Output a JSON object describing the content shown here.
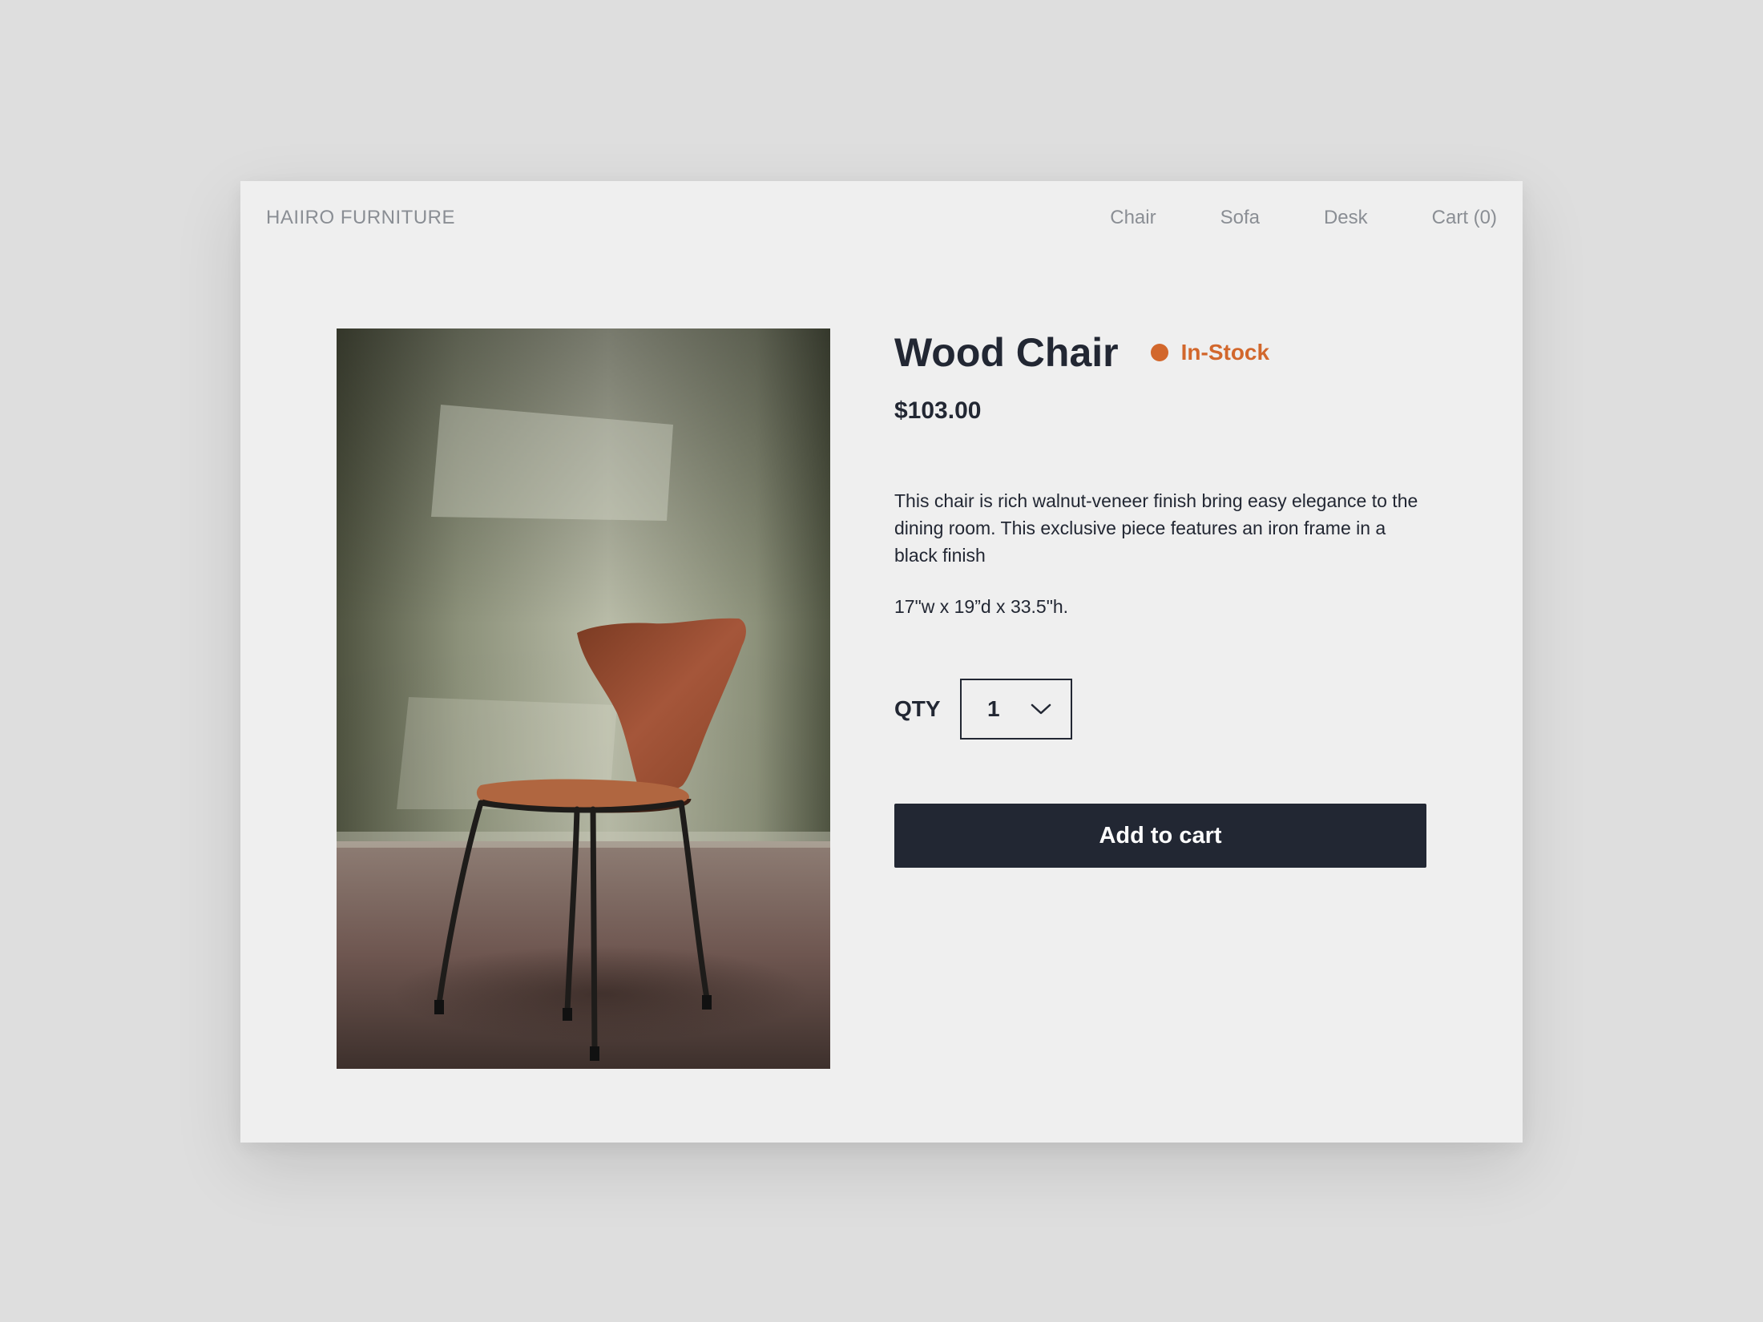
{
  "header": {
    "brand": "HAIIRO FURNITURE",
    "nav": [
      {
        "label": "Chair"
      },
      {
        "label": "Sofa"
      },
      {
        "label": "Desk"
      },
      {
        "label": "Cart (0)"
      }
    ]
  },
  "product": {
    "name": "Wood Chair",
    "stock_status": "In-Stock",
    "price": "$103.00",
    "description": "This chair is rich walnut-veneer finish bring easy elegance to the dining room. This exclusive piece features an iron frame in a black finish",
    "dimensions": "17\"w x 19”d x 33.5\"h."
  },
  "purchase": {
    "qty_label": "QTY",
    "qty_value": "1",
    "add_to_cart_label": "Add to cart"
  },
  "colors": {
    "accent": "#d2672c",
    "primary_dark": "#222733",
    "muted_text": "#8a8e94",
    "page_background": "#dedede",
    "card_background": "#efefef"
  },
  "icons": {
    "qty_dropdown": "chevron-down-icon"
  }
}
